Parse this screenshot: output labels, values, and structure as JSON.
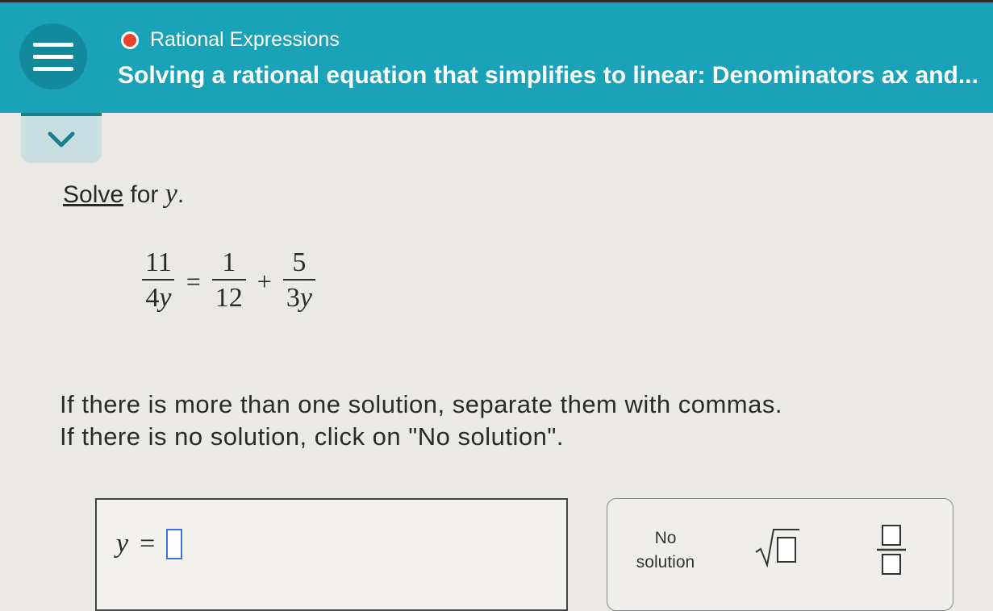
{
  "header": {
    "topic": "Rational Expressions",
    "lesson_title": "Solving a rational equation that simplifies to linear: Denominators ax and...",
    "colors": {
      "bar": "#1aa3b8",
      "dot": "#e8412c"
    }
  },
  "icons": {
    "menu": "hamburger-menu-icon",
    "collapse": "chevron-down-icon",
    "sqrt": "square-root-icon",
    "fraction": "fraction-icon"
  },
  "question": {
    "prefix_link": "Solve",
    "middle": " for ",
    "variable": "y",
    "suffix": "."
  },
  "equation": {
    "lhs": {
      "num": "11",
      "den_coef": "4",
      "den_var": "y"
    },
    "eq": "=",
    "rhs1": {
      "num": "1",
      "den": "12"
    },
    "plus": "+",
    "rhs2": {
      "num": "5",
      "den_coef": "3",
      "den_var": "y"
    }
  },
  "instructions": {
    "line1": "If there is more than one solution, separate them with commas.",
    "line2": "If there is no solution, click on \"No solution\"."
  },
  "answer": {
    "variable": "y",
    "equals": "=",
    "value": ""
  },
  "tools": {
    "no_solution_line1": "No",
    "no_solution_line2": "solution"
  }
}
